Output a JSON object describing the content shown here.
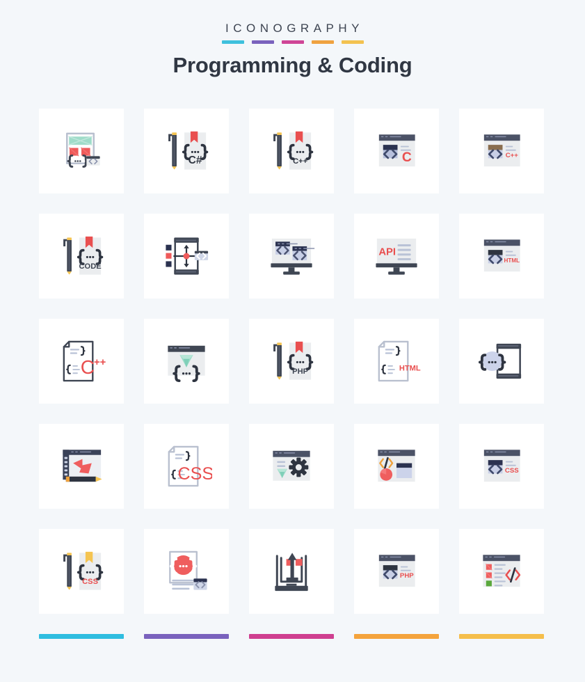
{
  "header": {
    "eyebrow": "ICONOGRAPHY",
    "title": "Programming & Coding",
    "swatch_colors": [
      "#3ec0dd",
      "#7a62bd",
      "#cf4596",
      "#efa240",
      "#f3c250"
    ]
  },
  "footer": {
    "bar_colors": [
      "#2fbde0",
      "#7a62bd",
      "#cf3f90",
      "#f4a33c",
      "#f5be4b"
    ]
  },
  "palette": {
    "background": "#f4f7fa",
    "card": "#ffffff",
    "dark": "#3f4653",
    "darker": "#2e3440",
    "navy": "#2b3250",
    "red": "#e94f4f",
    "red_soft": "#ef5a5a",
    "mint": "#9fdcc9",
    "lavender": "#ced3ea",
    "panel": "#ebedef",
    "line": "#b9c0cf",
    "gold": "#f5c451",
    "brown": "#8a6e4f",
    "green": "#5aa83c"
  },
  "icons": [
    {
      "row": 1,
      "col": 1,
      "name": "web-design-layout-code",
      "label": "",
      "kind": "layout-code"
    },
    {
      "row": 1,
      "col": 2,
      "name": "csharp-pen-bookmark",
      "label": "C#",
      "kind": "pen-bookmark",
      "bookmark": "#e94f4f"
    },
    {
      "row": 1,
      "col": 3,
      "name": "cplusplus-pen-bookmark",
      "label": "C++",
      "kind": "pen-bookmark",
      "bookmark": "#e94f4f"
    },
    {
      "row": 1,
      "col": 4,
      "name": "c-browser-window",
      "label": "C",
      "kind": "browser-code",
      "header": "#4b5266"
    },
    {
      "row": 1,
      "col": 5,
      "name": "cplusplus-browser-window",
      "label": "C++",
      "kind": "browser-code",
      "header": "#4b5266",
      "inner": "#8a6e4f"
    },
    {
      "row": 2,
      "col": 1,
      "name": "code-pen-bookmark",
      "label": "CODE",
      "kind": "pen-bookmark",
      "bookmark": "#e94f4f",
      "label_color": "#3f4653"
    },
    {
      "row": 2,
      "col": 2,
      "name": "responsive-code-arrows",
      "label": "",
      "kind": "responsive"
    },
    {
      "row": 2,
      "col": 3,
      "name": "monitor-code-modules",
      "label": "",
      "kind": "monitor-modules"
    },
    {
      "row": 2,
      "col": 4,
      "name": "api-monitor",
      "label": "API",
      "kind": "monitor-text"
    },
    {
      "row": 2,
      "col": 5,
      "name": "html-browser-window",
      "label": "HTML",
      "kind": "browser-code",
      "header": "#4b5266",
      "inner": "#2e3440"
    },
    {
      "row": 3,
      "col": 1,
      "name": "cplusplus-document",
      "label": "C++",
      "kind": "doc-lang"
    },
    {
      "row": 3,
      "col": 2,
      "name": "ruby-browser-gem",
      "label": "",
      "kind": "browser-gem"
    },
    {
      "row": 3,
      "col": 3,
      "name": "php-pen-bookmark",
      "label": "PHP",
      "kind": "pen-bookmark",
      "bookmark": "#e94f4f",
      "label_color": "#3f4653"
    },
    {
      "row": 3,
      "col": 4,
      "name": "html-document",
      "label": "HTML",
      "kind": "doc-lang"
    },
    {
      "row": 3,
      "col": 5,
      "name": "mobile-coding",
      "label": "",
      "kind": "mobile-code"
    },
    {
      "row": 4,
      "col": 1,
      "name": "web-design-tool-pencil",
      "label": "",
      "kind": "design-tool"
    },
    {
      "row": 4,
      "col": 2,
      "name": "css-document",
      "label": "CSS",
      "kind": "doc-lang"
    },
    {
      "row": 4,
      "col": 3,
      "name": "ruby-settings-browser",
      "label": "",
      "kind": "browser-gear"
    },
    {
      "row": 4,
      "col": 4,
      "name": "analytics-code-browser",
      "label": "",
      "kind": "browser-chart"
    },
    {
      "row": 4,
      "col": 5,
      "name": "css-browser-window",
      "label": "CSS",
      "kind": "browser-code",
      "header": "#4b5266",
      "inner": "#2b3250"
    },
    {
      "row": 5,
      "col": 1,
      "name": "css-pen-bookmark",
      "label": "CSS",
      "kind": "pen-bookmark",
      "bookmark": "#f5c451"
    },
    {
      "row": 5,
      "col": 2,
      "name": "code-document-badge",
      "label": "",
      "kind": "doc-badge"
    },
    {
      "row": 5,
      "col": 3,
      "name": "code-deploy-stand",
      "label": "",
      "kind": "deploy"
    },
    {
      "row": 5,
      "col": 4,
      "name": "php-browser-window",
      "label": "PHP",
      "kind": "browser-code",
      "header": "#4b5266",
      "inner": "#2e3440"
    },
    {
      "row": 5,
      "col": 5,
      "name": "code-list-browser",
      "label": "",
      "kind": "browser-list"
    }
  ]
}
